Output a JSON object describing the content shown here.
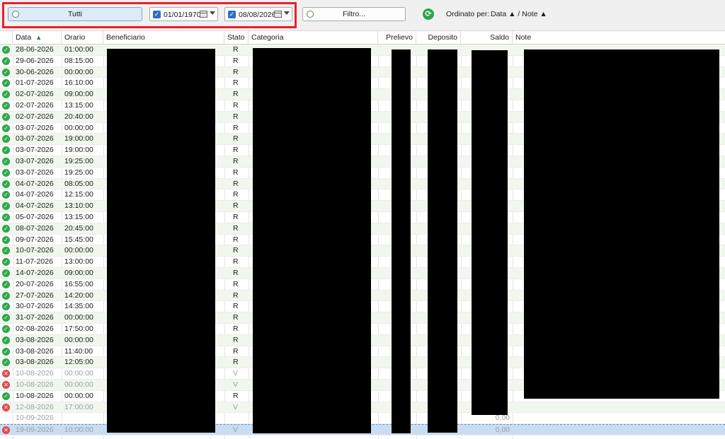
{
  "toolbar": {
    "all_label": "Tutti",
    "date_from": "01/01/1970",
    "date_to": "08/08/2026",
    "filter_label": "Filtro...",
    "sort_label": "Ordinato per:",
    "sort_value": "Data ▲ / Note ▲"
  },
  "columns": {
    "data": "Data",
    "orario": "Orario",
    "beneficiario": "Beneficiario",
    "stato": "Stato",
    "categoria": "Categoria",
    "prelievo": "Prelievo",
    "deposito": "Deposito",
    "saldo": "Saldo",
    "note": "Note"
  },
  "rows": [
    {
      "status": "ok",
      "date": "28-06-2026",
      "time": "01:00:00",
      "stato": "R",
      "saldo": ""
    },
    {
      "status": "ok",
      "date": "29-06-2026",
      "time": "08:15:00",
      "stato": "R",
      "saldo": ""
    },
    {
      "status": "ok",
      "date": "30-06-2026",
      "time": "00:00:00",
      "stato": "R",
      "saldo": ""
    },
    {
      "status": "ok",
      "date": "01-07-2026",
      "time": "16:10:00",
      "stato": "R",
      "saldo": ""
    },
    {
      "status": "ok",
      "date": "02-07-2026",
      "time": "09:00:00",
      "stato": "R",
      "saldo": ""
    },
    {
      "status": "ok",
      "date": "02-07-2026",
      "time": "13:15:00",
      "stato": "R",
      "saldo": ""
    },
    {
      "status": "ok",
      "date": "02-07-2026",
      "time": "20:40:00",
      "stato": "R",
      "saldo": ""
    },
    {
      "status": "ok",
      "date": "03-07-2026",
      "time": "00:00:00",
      "stato": "R",
      "saldo": ""
    },
    {
      "status": "ok",
      "date": "03-07-2026",
      "time": "19:00:00",
      "stato": "R",
      "saldo": ""
    },
    {
      "status": "ok",
      "date": "03-07-2026",
      "time": "19:00:00",
      "stato": "R",
      "saldo": ""
    },
    {
      "status": "ok",
      "date": "03-07-2026",
      "time": "19:25:00",
      "stato": "R",
      "saldo": ""
    },
    {
      "status": "ok",
      "date": "03-07-2026",
      "time": "19:25:00",
      "stato": "R",
      "saldo": ""
    },
    {
      "status": "ok",
      "date": "04-07-2026",
      "time": "08:05:00",
      "stato": "R",
      "saldo": ""
    },
    {
      "status": "ok",
      "date": "04-07-2026",
      "time": "12:15:00",
      "stato": "R",
      "saldo": ""
    },
    {
      "status": "ok",
      "date": "04-07-2026",
      "time": "13:10:00",
      "stato": "R",
      "saldo": ""
    },
    {
      "status": "ok",
      "date": "05-07-2026",
      "time": "13:15:00",
      "stato": "R",
      "saldo": ""
    },
    {
      "status": "ok",
      "date": "08-07-2026",
      "time": "20:45:00",
      "stato": "R",
      "saldo": ""
    },
    {
      "status": "ok",
      "date": "09-07-2026",
      "time": "15:45:00",
      "stato": "R",
      "saldo": ""
    },
    {
      "status": "ok",
      "date": "10-07-2026",
      "time": "00:00:00",
      "stato": "R",
      "saldo": ""
    },
    {
      "status": "ok",
      "date": "11-07-2026",
      "time": "13:00:00",
      "stato": "R",
      "saldo": ""
    },
    {
      "status": "ok",
      "date": "14-07-2026",
      "time": "09:00:00",
      "stato": "R",
      "saldo": ""
    },
    {
      "status": "ok",
      "date": "20-07-2026",
      "time": "16:55:00",
      "stato": "R",
      "saldo": ""
    },
    {
      "status": "ok",
      "date": "27-07-2026",
      "time": "14:20:00",
      "stato": "R",
      "saldo": ""
    },
    {
      "status": "ok",
      "date": "30-07-2026",
      "time": "14:35:00",
      "stato": "R",
      "saldo": ""
    },
    {
      "status": "ok",
      "date": "31-07-2026",
      "time": "00:00:00",
      "stato": "R",
      "saldo": ""
    },
    {
      "status": "ok",
      "date": "02-08-2026",
      "time": "17:50:00",
      "stato": "R",
      "saldo": ""
    },
    {
      "status": "ok",
      "date": "03-08-2026",
      "time": "00:00:00",
      "stato": "R",
      "saldo": ""
    },
    {
      "status": "ok",
      "date": "03-08-2026",
      "time": "11:40:00",
      "stato": "R",
      "saldo": ""
    },
    {
      "status": "ok",
      "date": "03-08-2026",
      "time": "12:05:00",
      "stato": "R",
      "saldo": ""
    },
    {
      "status": "err",
      "date": "10-08-2026",
      "time": "00:00:00",
      "stato": "V",
      "saldo": ""
    },
    {
      "status": "err",
      "date": "10-08-2026",
      "time": "00:00:00",
      "stato": "V",
      "saldo": ""
    },
    {
      "status": "ok",
      "date": "10-08-2026",
      "time": "00:00:00",
      "stato": "R",
      "saldo": ""
    },
    {
      "status": "err",
      "date": "12-08-2026",
      "time": "17:00:00",
      "stato": "V",
      "saldo": ""
    },
    {
      "status": "none",
      "date": "10-09-2026",
      "time": "",
      "stato": "",
      "saldo": "0,00"
    },
    {
      "status": "err",
      "date": "19-09-2026",
      "time": "10:00:00",
      "stato": "V",
      "saldo": "0,00"
    }
  ]
}
